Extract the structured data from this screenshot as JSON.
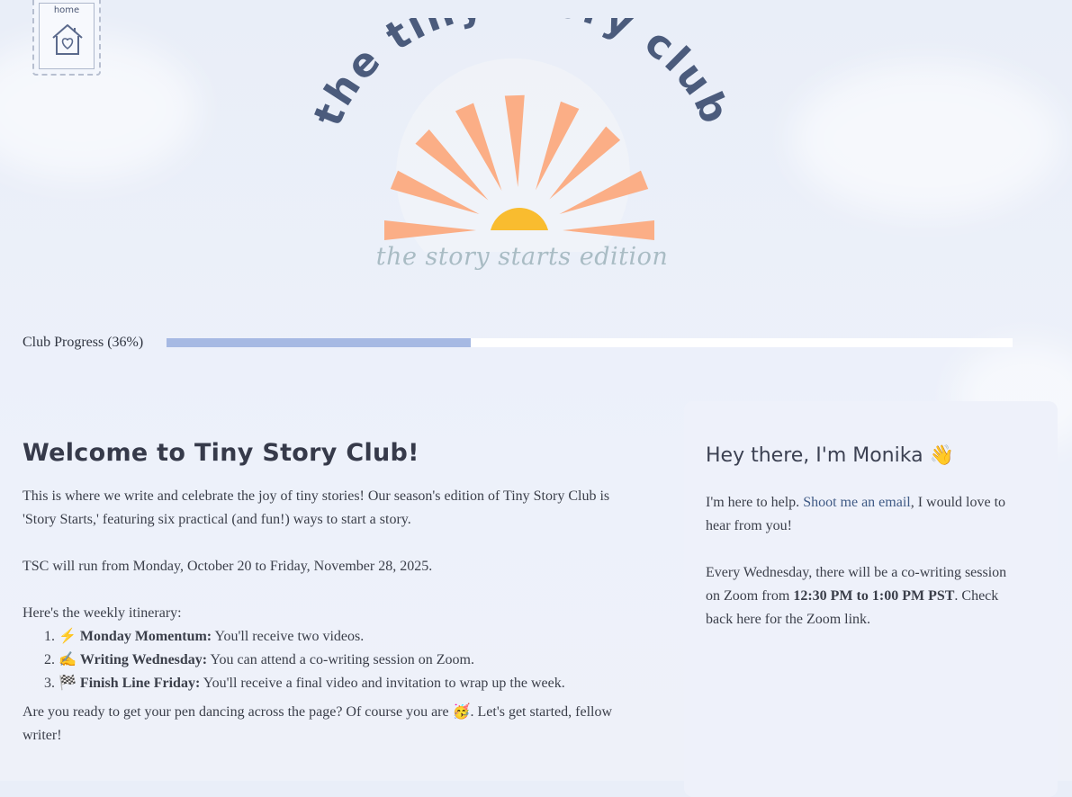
{
  "colors": {
    "background": "#e9eef8",
    "progress_fill": "#a6b9e3",
    "progress_track": "#ffffff",
    "sun": "#f9bc2f",
    "rays": "#fbae86",
    "title_text": "#4b5b7c",
    "subtitle_text": "#a9bcc4",
    "link": "#3f5a85"
  },
  "nav": {
    "home_stamp_label": "home",
    "home_icon": "house-heart-icon"
  },
  "logo": {
    "title": "the tiny story club",
    "subtitle": "the story starts edition",
    "icon": "sun-rays-icon"
  },
  "progress": {
    "label": "Club Progress (36%)",
    "percent": 36
  },
  "main": {
    "heading": "Welcome to Tiny Story Club!",
    "intro": "This is where we write and celebrate the joy of tiny stories! Our season's edition of Tiny Story Club is 'Story Starts,' featuring six practical (and fun!) ways to start a story.",
    "dates": "TSC will run from Monday, October 20 to Friday, November 28, 2025.",
    "itinerary_intro": "Here's the weekly itinerary:",
    "itinerary": [
      {
        "emoji": "⚡",
        "title": "Monday Momentum:",
        "text": " You'll receive two videos."
      },
      {
        "emoji": "✍️",
        "title": "Writing Wednesday:",
        "text": " You can attend a co-writing session on Zoom."
      },
      {
        "emoji": "🏁",
        "title": "Finish Line Friday:",
        "text": " You'll receive a final video and invitation to wrap up the week."
      }
    ],
    "closing_a": "Are you ready to get your pen dancing across the page? Of course you are ",
    "closing_emoji": "🥳",
    "closing_b": ". Let's get started, fellow writer!"
  },
  "side": {
    "greeting": "Hey there, I'm Monika 👋",
    "help_a": "I'm here to help. ",
    "help_link": "Shoot me an email",
    "help_b": ", I would love to hear from you!",
    "cowrite_a": "Every Wednesday, there will be a co-writing session on Zoom from ",
    "cowrite_time": "12:30 PM to 1:00 PM PST",
    "cowrite_b": ". Check back here for the Zoom link."
  }
}
